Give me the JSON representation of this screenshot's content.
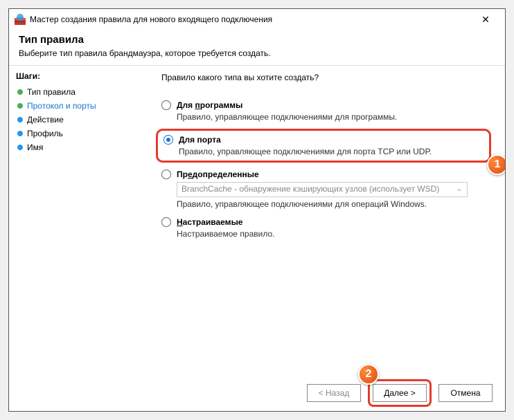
{
  "window": {
    "title": "Мастер создания правила для нового входящего подключения"
  },
  "header": {
    "title": "Тип правила",
    "subtitle": "Выберите тип правила брандмауэра, которое требуется создать."
  },
  "sidebar": {
    "title": "Шаги:",
    "steps": [
      {
        "label": "Тип правила",
        "state": "done"
      },
      {
        "label": "Протокол и порты",
        "state": "active"
      },
      {
        "label": "Действие",
        "state": "pending"
      },
      {
        "label": "Профиль",
        "state": "pending"
      },
      {
        "label": "Имя",
        "state": "pending"
      }
    ]
  },
  "main": {
    "prompt": "Правило какого типа вы хотите создать?",
    "options": {
      "program": {
        "label_pre": "Для ",
        "label_u": "п",
        "label_post": "рограммы",
        "desc": "Правило, управляющее подключениями для программы."
      },
      "port": {
        "label": "Для порта",
        "desc": "Правило, управляющее подключениями для порта TCP или UDP."
      },
      "predefined": {
        "label_pre": "Пр",
        "label_u": "е",
        "label_post": "допределенные",
        "select_value": "BranchCache - обнаружение кэширующих узлов (использует WSD)",
        "desc": "Правило, управляющее подключениями для операций Windows."
      },
      "custom": {
        "label_u": "Н",
        "label_post": "астраиваемые",
        "desc": "Настраиваемое правило."
      }
    }
  },
  "footer": {
    "back": "< Назад",
    "next": "Далее >",
    "cancel": "Отмена"
  },
  "annotations": {
    "badge1": "1",
    "badge2": "2"
  }
}
